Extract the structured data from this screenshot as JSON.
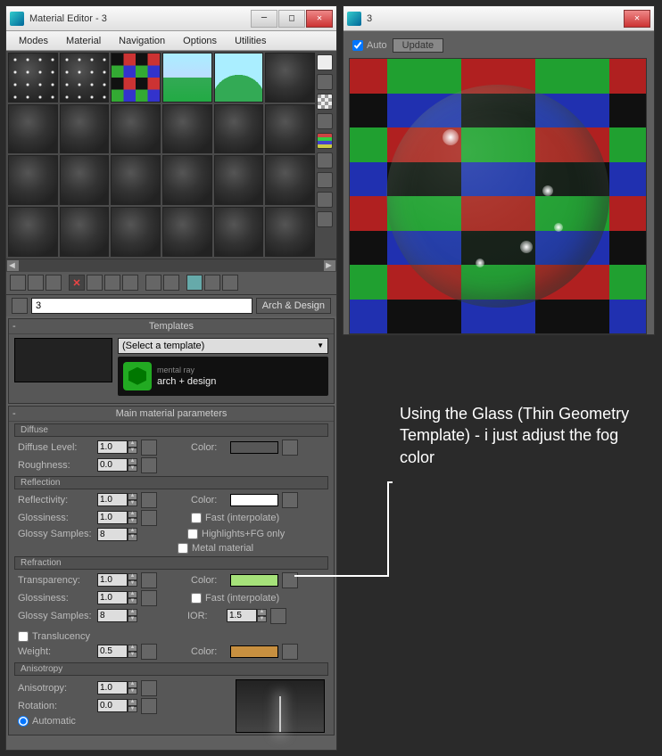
{
  "editor": {
    "title": "Material Editor - 3",
    "menu": [
      "Modes",
      "Material",
      "Navigation",
      "Options",
      "Utilities"
    ],
    "material_name": "3",
    "material_type": "Arch & Design",
    "templates": {
      "header": "Templates",
      "select": "(Select a template)",
      "mr_small": "mental ray",
      "mr_big": "arch + design"
    },
    "main_hdr": "Main material parameters",
    "diffuse": {
      "hdr": "Diffuse",
      "level_lbl": "Diffuse Level:",
      "level_val": "1.0",
      "rough_lbl": "Roughness:",
      "rough_val": "0.0",
      "color_lbl": "Color:",
      "color": "#000000"
    },
    "reflection": {
      "hdr": "Reflection",
      "refl_lbl": "Reflectivity:",
      "refl_val": "1.0",
      "gloss_lbl": "Glossiness:",
      "gloss_val": "1.0",
      "samples_lbl": "Glossy Samples:",
      "samples_val": "8",
      "color_lbl": "Color:",
      "color": "#ffffff",
      "fast": "Fast (interpolate)",
      "hfg": "Highlights+FG only",
      "metal": "Metal material"
    },
    "refraction": {
      "hdr": "Refraction",
      "trans_lbl": "Transparency:",
      "trans_val": "1.0",
      "gloss_lbl": "Glossiness:",
      "gloss_val": "1.0",
      "samples_lbl": "Glossy Samples:",
      "samples_val": "8",
      "color_lbl": "Color:",
      "color": "#a6e27a",
      "fast": "Fast (interpolate)",
      "ior_lbl": "IOR:",
      "ior_val": "1.5",
      "translucency": "Translucency",
      "weight_lbl": "Weight:",
      "weight_val": "0.5",
      "tcolor_lbl": "Color:",
      "tcolor": "#c89040"
    },
    "aniso": {
      "hdr": "Anisotropy",
      "aniso_lbl": "Anisotropy:",
      "aniso_val": "1.0",
      "rot_lbl": "Rotation:",
      "rot_val": "0.0",
      "auto": "Automatic"
    }
  },
  "preview": {
    "title": "3",
    "auto": "Auto",
    "update": "Update",
    "checker_colors": [
      "#b02020",
      "#2030b0",
      "#20a030",
      "#101010"
    ]
  },
  "annotation": "Using the Glass (Thin Geometry Template) - i just adjust the fog color"
}
